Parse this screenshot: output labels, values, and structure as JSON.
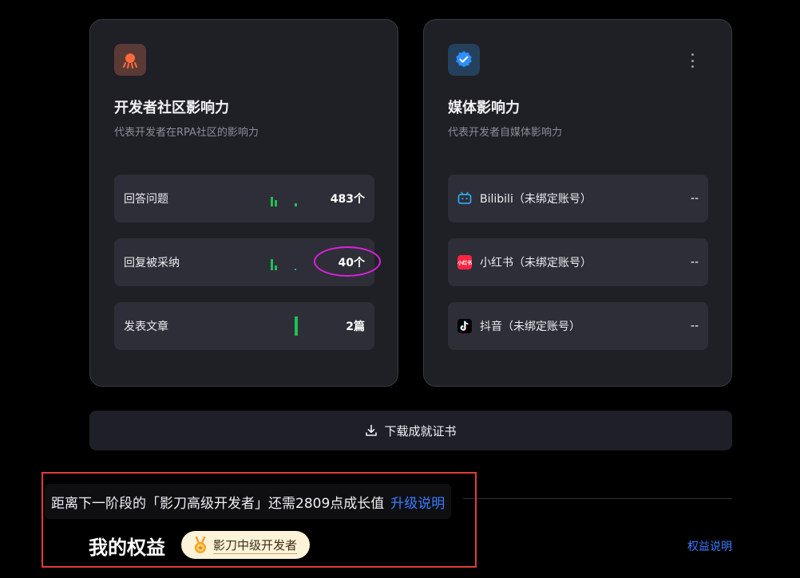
{
  "dev_card": {
    "title": "开发者社区影响力",
    "subtitle": "代表开发者在RPA社区的影响力",
    "rows": [
      {
        "label": "回答问题",
        "value": "483个"
      },
      {
        "label": "回复被采纳",
        "value": "40个"
      },
      {
        "label": "发表文章",
        "value": "2篇"
      }
    ]
  },
  "media_card": {
    "title": "媒体影响力",
    "subtitle": "代表开发者自媒体影响力",
    "rows": [
      {
        "label": "Bilibili（未绑定账号）",
        "value": "--",
        "icon": "bilibili-icon"
      },
      {
        "label": "小红书（未绑定账号）",
        "value": "--",
        "icon": "xiaohongshu-icon",
        "icon_text": "小红书"
      },
      {
        "label": "抖音（未绑定账号）",
        "value": "--",
        "icon": "douyin-icon"
      }
    ]
  },
  "download_label": "下载成就证书",
  "notice": {
    "text": "距离下一阶段的「影刀高级开发者」还需2809点成长值",
    "link": "升级说明"
  },
  "rights": {
    "title": "我的权益",
    "badge": "影刀中级开发者",
    "link": "权益说明"
  },
  "colors": {
    "accent": "#3b7cff",
    "spark": "#1fbf54",
    "highlight": "#e020e0",
    "annotation": "#e33b3b"
  }
}
